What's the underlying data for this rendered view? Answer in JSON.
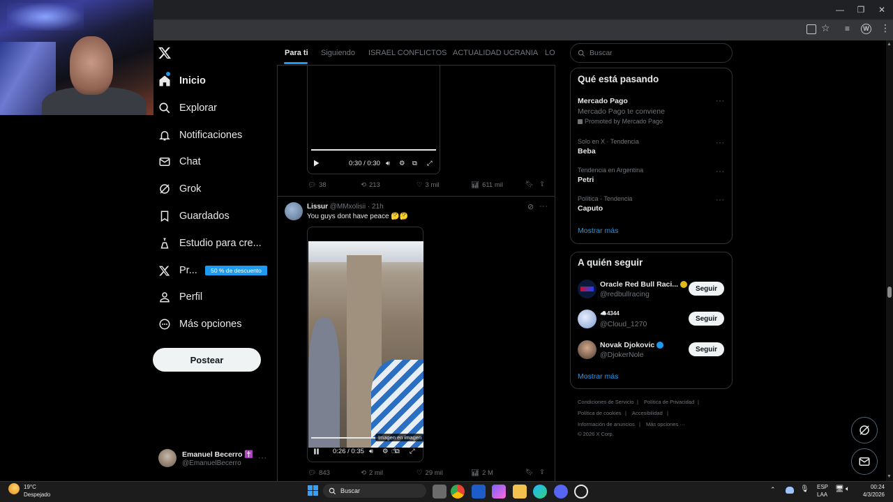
{
  "nav": {
    "items": [
      {
        "label": "Inicio",
        "icon": "home-icon"
      },
      {
        "label": "Explorar",
        "icon": "search-icon"
      },
      {
        "label": "Notificaciones",
        "icon": "bell-icon"
      },
      {
        "label": "Chat",
        "icon": "mail-icon"
      },
      {
        "label": "Grok",
        "icon": "grok-icon"
      },
      {
        "label": "Guardados",
        "icon": "bookmark-icon"
      },
      {
        "label": "Estudio para cre...",
        "icon": "flask-icon"
      },
      {
        "label": "Pr...",
        "icon": "x-logo-icon"
      },
      {
        "label": "Perfil",
        "icon": "person-icon"
      },
      {
        "label": "Más opciones",
        "icon": "more-circle-icon"
      }
    ],
    "promo_badge": "50 % de descuento",
    "post_button": "Postear"
  },
  "account": {
    "name": "Emanuel Becerro ✝️",
    "handle": "@EmanuelBecerro",
    "menu": "···"
  },
  "tabs": [
    "Para ti",
    "Siguiendo",
    "ISRAEL CONFLICTOS",
    "ACTUALIDAD UCRANIA",
    "LO"
  ],
  "tweet1": {
    "video_time": "0:30 / 0:30",
    "replies": "38",
    "reposts": "213",
    "likes": "3 mil",
    "views": "611 mil"
  },
  "tweet2": {
    "author": "Lissur",
    "handle": "@MMxolisii",
    "time": "· 21h",
    "text": "You guys dont have peace 🤔🤔",
    "pip_label": "Imagen en imagen",
    "video_time": "0:26 / 0:35",
    "replies": "843",
    "reposts": "2 mil",
    "likes": "29 mil",
    "views": "2 M"
  },
  "search": {
    "placeholder": "Buscar"
  },
  "trending": {
    "title": "Qué está pasando",
    "promo": {
      "title": "Mercado Pago",
      "subtitle": "Mercado Pago te conviene",
      "promoted": "Promoted by Mercado Pago"
    },
    "items": [
      {
        "context": "Solo en X · Tendencia",
        "name": "Beba"
      },
      {
        "context": "Tendencia en Argentina",
        "name": "Petri"
      },
      {
        "context": "Política · Tendencia",
        "name": "Caputo"
      }
    ],
    "show_more": "Mostrar más"
  },
  "who_to_follow": {
    "title": "A quién seguir",
    "accounts": [
      {
        "name": "Oracle Red Bull Raci...",
        "handle": "@redbullracing",
        "button": "Seguir"
      },
      {
        "name": "☁️4344",
        "handle": "@Cloud_1270",
        "button": "Seguir"
      },
      {
        "name": "Novak Djokovic",
        "handle": "@DjokerNole",
        "button": "Seguir"
      }
    ],
    "show_more": "Mostrar más"
  },
  "footer": {
    "terms": "Condiciones de Servicio",
    "privacy": "Política de Privacidad",
    "cookies": "Política de cookies",
    "accessibility": "Accesibilidad",
    "ads": "Información de anuncios",
    "more": "Más opciones ···",
    "copyright": "© 2026 X Corp."
  },
  "taskbar": {
    "weather_temp": "19°C",
    "weather_desc": "Despejado",
    "search": "Buscar",
    "lang1": "ESP",
    "lang2": "LAA",
    "time": "00:24",
    "date": "4/3/2026"
  },
  "colors": {
    "accent": "#1d9bf0",
    "background": "#000000",
    "border": "#2f3336",
    "muted": "#71767b"
  }
}
